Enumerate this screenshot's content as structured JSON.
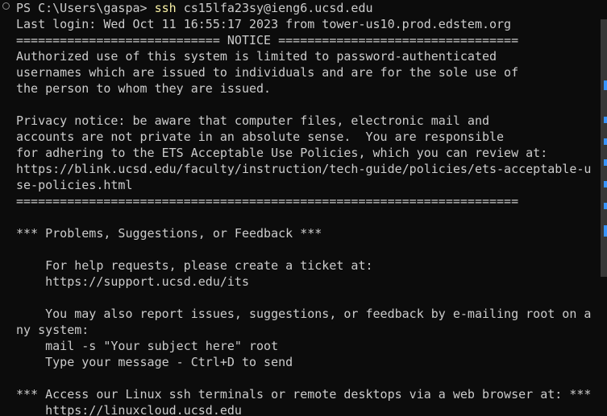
{
  "terminal": {
    "prompt": "PS C:\\Users\\gaspa> ",
    "command": "ssh",
    "command_args": " cs15lfa23sy@ieng6.ucsd.edu",
    "colors": {
      "background": "#0c0c0c",
      "foreground": "#cccccc",
      "command": "#f9f1a5",
      "scroll_marker": "#3794ff"
    },
    "output_lines": [
      "Last login: Wed Oct 11 16:55:17 2023 from tower-us10.prod.edstem.org",
      "============================ NOTICE =================================",
      "Authorized use of this system is limited to password-authenticated",
      "usernames which are issued to individuals and are for the sole use of",
      "the person to whom they are issued.",
      "",
      "Privacy notice: be aware that computer files, electronic mail and",
      "accounts are not private in an absolute sense.  You are responsible",
      "for adhering to the ETS Acceptable Use Policies, which you can review at:",
      "https://blink.ucsd.edu/faculty/instruction/tech-guide/policies/ets-acceptable-u",
      "se-policies.html",
      "=====================================================================",
      "",
      "*** Problems, Suggestions, or Feedback ***",
      "",
      "    For help requests, please create a ticket at:",
      "    https://support.ucsd.edu/its",
      "",
      "    You may also report issues, suggestions, or feedback by e-mailing root on a",
      "ny system:",
      "    mail -s \"Your subject here\" root",
      "    Type your message - Ctrl+D to send",
      "",
      "*** Access our Linux ssh terminals or remote desktops via a web browser at: ***",
      "    https://linuxcloud.ucsd.edu"
    ]
  }
}
